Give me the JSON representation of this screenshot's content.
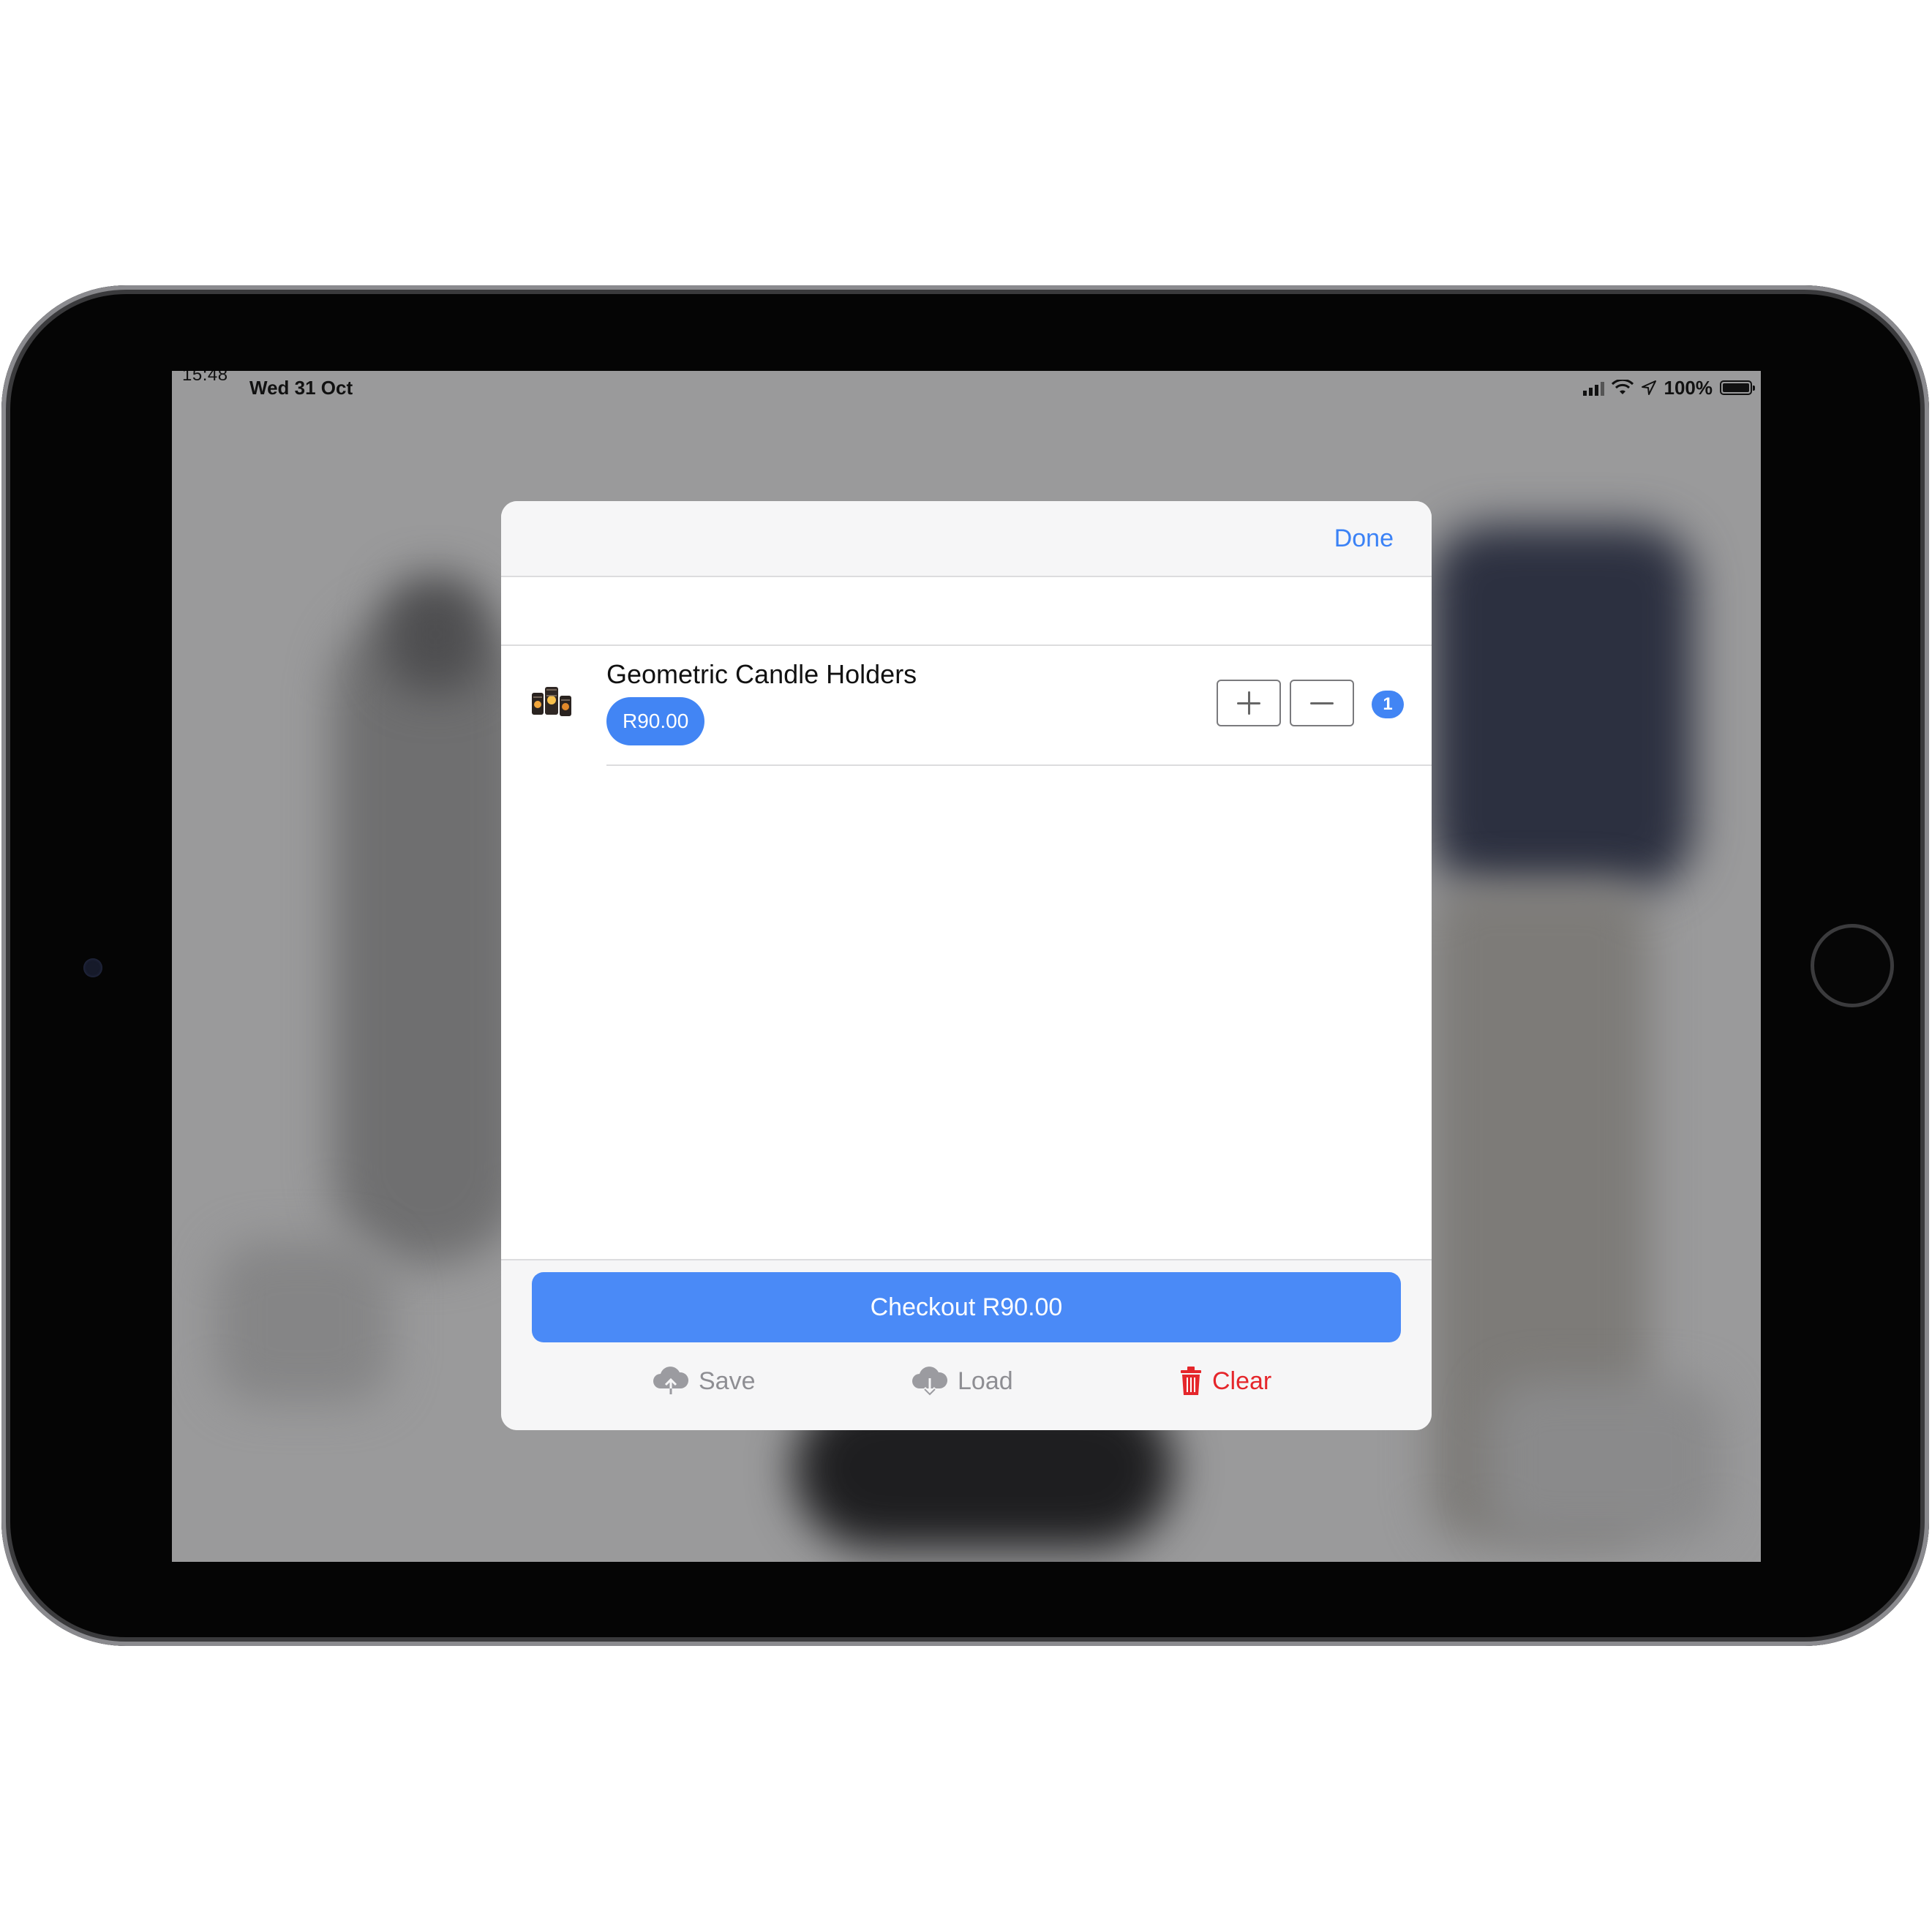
{
  "status_bar": {
    "time": "15:48",
    "date": "Wed 31 Oct",
    "battery": "100%"
  },
  "modal": {
    "done_label": "Done",
    "search_placeholder": "",
    "items": [
      {
        "name": "Geometric Candle Holders",
        "price": "R90.00",
        "quantity": "1",
        "thumbnail_icon": "candle-holders-icon"
      }
    ],
    "checkout_label": "Checkout R90.00",
    "actions": {
      "save_label": "Save",
      "load_label": "Load",
      "clear_label": "Clear"
    }
  },
  "colors": {
    "accent": "#4285f4",
    "destructive": "#e5262b",
    "muted": "#8e8e93"
  }
}
